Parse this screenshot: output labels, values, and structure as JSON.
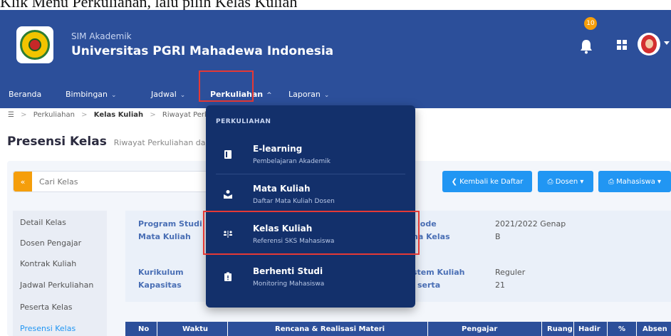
{
  "instruction": "Klik Menu Perkuliahan, lalu pilih Kelas Kuliah",
  "header": {
    "subtitle": "SIM Akademik",
    "title": "Universitas PGRI Mahadewa Indonesia",
    "notification_count": "10"
  },
  "nav": {
    "items": [
      {
        "label": "Beranda",
        "chevron": ""
      },
      {
        "label": "Bimbingan",
        "chevron": "⌄"
      },
      {
        "label": "Jadwal",
        "chevron": "⌄"
      },
      {
        "label": "Perkuliahan",
        "chevron": "^"
      },
      {
        "label": "Laporan",
        "chevron": "⌄"
      }
    ]
  },
  "breadcrumb": {
    "items": [
      "Perkuliahan",
      "Kelas Kuliah",
      "Riwayat Perkulia"
    ],
    "separator": ">"
  },
  "page": {
    "title": "Presensi Kelas",
    "subtitle": "Riwayat Perkuliahan dan"
  },
  "search": {
    "button": "«",
    "placeholder": "Cari Kelas"
  },
  "buttons": {
    "back": "❮ Kembali ke Daftar",
    "dosen": "⎙ Dosen ▾",
    "mahasiswa": "⎙ Mahasiswa ▾"
  },
  "sidebar": {
    "items": [
      "Detail Kelas",
      "Dosen Pengajar",
      "Kontrak Kuliah",
      "Jadwal Perkuliahan",
      "Peserta Kelas",
      "Presensi Kelas"
    ]
  },
  "info": {
    "program_studi_label": "Program Studi",
    "mata_kuliah_label": "Mata Kuliah",
    "kurikulum_label": "Kurikulum",
    "kapasitas_label": "Kapasitas",
    "kode_label": "iode",
    "kode_value": "2021/2022 Genap",
    "nama_kelas_label": "na Kelas",
    "nama_kelas_value": "B",
    "sistem_kuliah_label": "stem Kuliah",
    "sistem_kuliah_value": "Reguler",
    "peserta_label": "serta",
    "peserta_value": "21"
  },
  "table": {
    "headers": [
      "No",
      "Waktu",
      "Rencana & Realisasi Materi",
      "Pengajar",
      "Ruang",
      "Hadir",
      "%",
      "Absen"
    ]
  },
  "dropdown": {
    "header": "PERKULIAHAN",
    "items": [
      {
        "title": "E-learning",
        "desc": "Pembelajaran Akademik",
        "icon": "book-icon"
      },
      {
        "title": "Mata Kuliah",
        "desc": "Daftar Mata Kuliah Dosen",
        "icon": "teacher-icon"
      },
      {
        "title": "Kelas Kuliah",
        "desc": "Referensi SKS Mahasiswa",
        "icon": "class-icon"
      },
      {
        "title": "Berhenti Studi",
        "desc": "Monitoring Mahasiswa",
        "icon": "clipboard-icon"
      }
    ]
  },
  "colors": {
    "header_bg": "#2c4f9a",
    "dropdown_bg": "#13306b",
    "accent_blue": "#2196f3",
    "accent_orange": "#f59e0b",
    "highlight_red": "#e53935"
  }
}
